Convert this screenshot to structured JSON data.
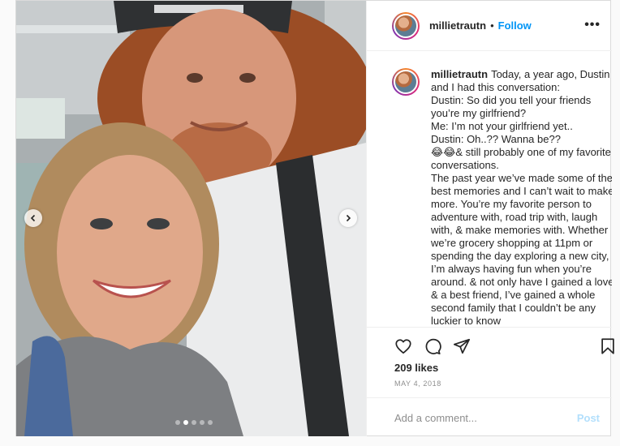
{
  "post": {
    "username": "millietrautn",
    "separator": "•",
    "follow_label": "Follow",
    "more_icon": "more-options-icon",
    "more_glyph": "•••",
    "caption": {
      "username": "millietrautn",
      "text": "Today, a year ago, Dustin and I had this conversation:\nDustin: So did you tell your friends you’re my girlfriend?\nMe: I’m not your girlfriend yet..\nDustin: Oh..?? Wanna be??\n😂😂& still probably one of my favorite conversations.\nThe past year we’ve made some of the best memories and I can’t wait to make more. You’re my favorite person to adventure with, road trip with, laugh with, & make memories with. Whether we’re grocery shopping at 11pm or spending the day exploring a new city, I’m always having fun when you’re around. & not only have I gained a love & a best friend, I’ve gained a whole second family that I couldn’t be any luckier to know"
    },
    "likes": "209 likes",
    "date": "MAY 4, 2018",
    "comment": {
      "placeholder": "Add a comment...",
      "value": "",
      "post_label": "Post"
    },
    "carousel": {
      "slide_count": 5,
      "active_index": 1,
      "prev_icon": "chevron-left-icon",
      "next_icon": "chevron-right-icon"
    },
    "icons": [
      "heart-icon",
      "comment-icon",
      "share-icon",
      "bookmark-icon"
    ]
  },
  "colors": {
    "link_blue": "#0095f6",
    "post_disabled": "#b2dffc",
    "text": "#262626",
    "muted": "#8e8e8e",
    "border": "#dbdbdb"
  }
}
